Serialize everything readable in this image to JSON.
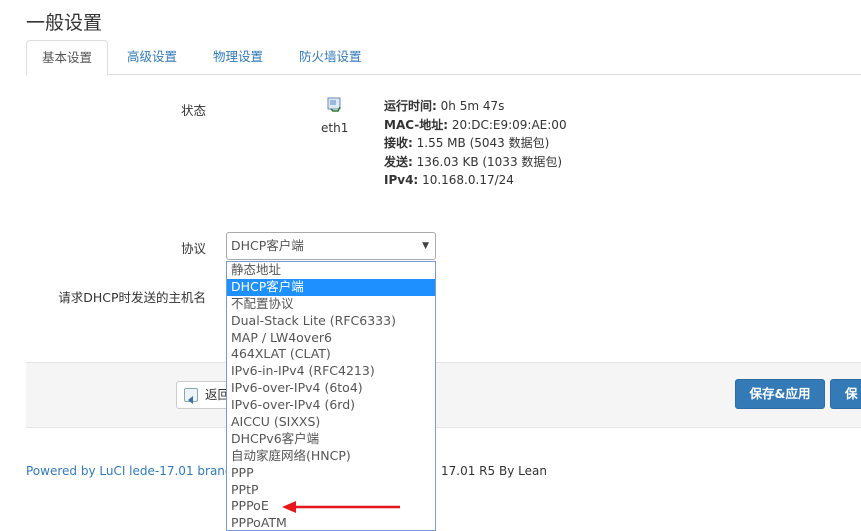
{
  "page": {
    "title": "一般设置"
  },
  "tabs": [
    {
      "label": "基本设置",
      "active": true
    },
    {
      "label": "高级设置",
      "active": false
    },
    {
      "label": "物理设置",
      "active": false
    },
    {
      "label": "防火墙设置",
      "active": false
    }
  ],
  "status": {
    "label": "状态",
    "interface": "eth1",
    "icon": "network-interface-icon",
    "uptime_label": "运行时间:",
    "uptime_value": "0h 5m 47s",
    "mac_label": "MAC-地址:",
    "mac_value": "20:DC:E9:09:AE:00",
    "rx_label": "接收:",
    "rx_value": "1.55 MB (5043 数据包)",
    "tx_label": "发送:",
    "tx_value": "136.03 KB (1033 数据包)",
    "ipv4_label": "IPv4:",
    "ipv4_value": "10.168.0.17/24"
  },
  "protocol": {
    "label": "协议",
    "selected": "DHCP客户端",
    "options": [
      "静态地址",
      "DHCP客户端",
      "不配置协议",
      "Dual-Stack Lite (RFC6333)",
      "MAP / LW4over6",
      "464XLAT (CLAT)",
      "IPv6-in-IPv4 (RFC4213)",
      "IPv6-over-IPv4 (6to4)",
      "IPv6-over-IPv4 (6rd)",
      "AICCU (SIXXS)",
      "DHCPv6客户端",
      "自动家庭网络(HNCP)",
      "PPP",
      "PPtP",
      "PPPoE",
      "PPPoATM"
    ],
    "selected_index": 1
  },
  "hostname": {
    "label": "请求DHCP时发送的主机名"
  },
  "actions": {
    "back_label": "返回",
    "save_apply_label": "保存&应用",
    "save_label": "保存"
  },
  "footer": {
    "powered_by": "Powered by LuCI lede-17.01 branch",
    "version": "17.01 R5 By Lean"
  },
  "colors": {
    "accent": "#337ab7",
    "selected_option": "#1e90ff",
    "annotation_arrow": "#e8161c"
  }
}
